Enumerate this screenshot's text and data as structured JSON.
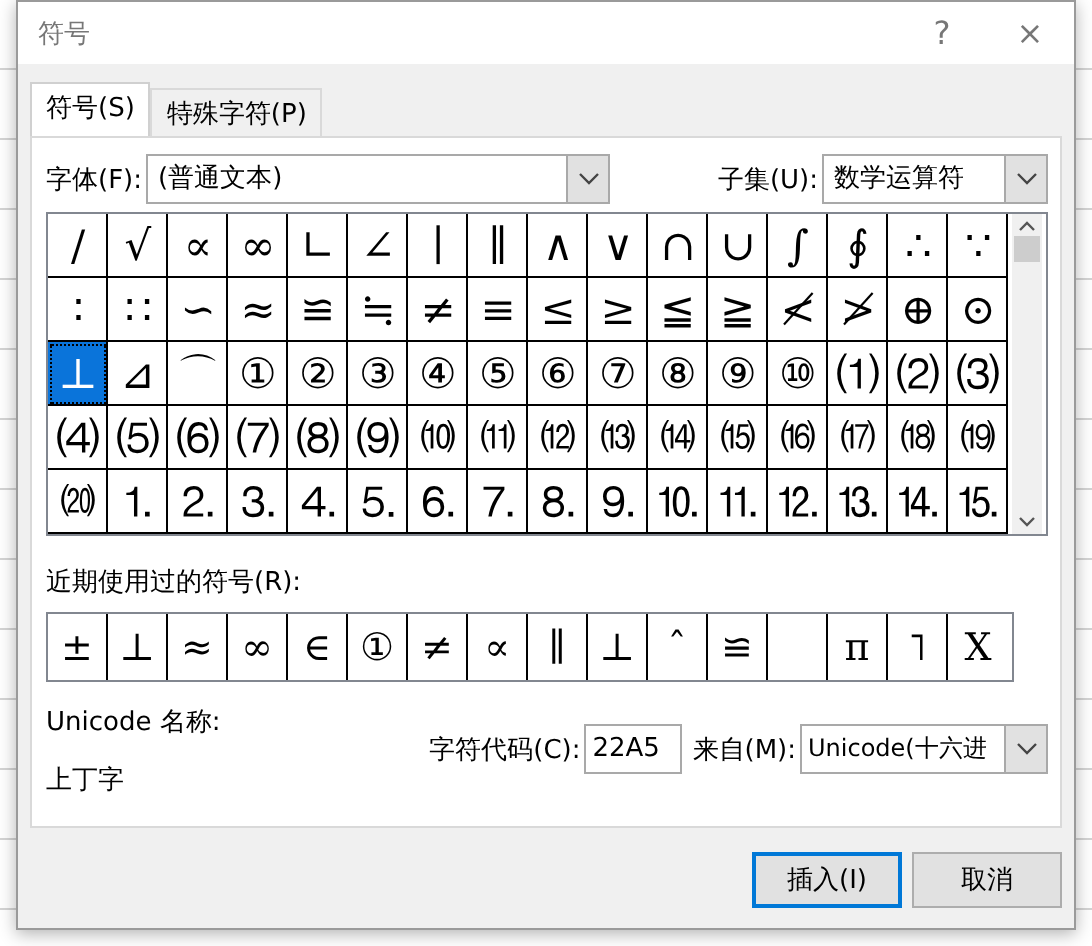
{
  "window": {
    "title": "符号",
    "help": "?",
    "close": "×"
  },
  "tabs": [
    {
      "label": "符号(S)",
      "selected": true
    },
    {
      "label": "特殊字符(P)",
      "selected": false
    }
  ],
  "font": {
    "label": "字体(F):",
    "value": "(普通文本)"
  },
  "subset": {
    "label": "子集(U):",
    "value": "数学运算符"
  },
  "symbols": [
    {
      "char": "/",
      "selected": false
    },
    {
      "char": "√",
      "selected": false
    },
    {
      "char": "∝",
      "selected": false
    },
    {
      "char": "∞",
      "selected": false
    },
    {
      "char": "∟",
      "selected": false
    },
    {
      "char": "∠",
      "selected": false
    },
    {
      "char": "∣",
      "selected": false
    },
    {
      "char": "∥",
      "selected": false
    },
    {
      "char": "∧",
      "selected": false
    },
    {
      "char": "∨",
      "selected": false
    },
    {
      "char": "∩",
      "selected": false
    },
    {
      "char": "∪",
      "selected": false
    },
    {
      "char": "∫",
      "selected": false
    },
    {
      "char": "∮",
      "selected": false
    },
    {
      "char": "∴",
      "selected": false
    },
    {
      "char": "∵",
      "selected": false
    },
    {
      "char": "∶",
      "selected": false
    },
    {
      "char": "∷",
      "selected": false
    },
    {
      "char": "∽",
      "selected": false
    },
    {
      "char": "≈",
      "selected": false
    },
    {
      "char": "≌",
      "selected": false
    },
    {
      "char": "≒",
      "selected": false
    },
    {
      "char": "≠",
      "selected": false
    },
    {
      "char": "≡",
      "selected": false
    },
    {
      "char": "≤",
      "selected": false
    },
    {
      "char": "≥",
      "selected": false
    },
    {
      "char": "≦",
      "selected": false
    },
    {
      "char": "≧",
      "selected": false
    },
    {
      "char": "≮",
      "selected": false
    },
    {
      "char": "≯",
      "selected": false
    },
    {
      "char": "⊕",
      "selected": false
    },
    {
      "char": "⊙",
      "selected": false
    },
    {
      "char": "⊥",
      "selected": true
    },
    {
      "char": "⊿",
      "selected": false
    },
    {
      "char": "⌒",
      "selected": false
    },
    {
      "char": "①",
      "selected": false
    },
    {
      "char": "②",
      "selected": false
    },
    {
      "char": "③",
      "selected": false
    },
    {
      "char": "④",
      "selected": false
    },
    {
      "char": "⑤",
      "selected": false
    },
    {
      "char": "⑥",
      "selected": false
    },
    {
      "char": "⑦",
      "selected": false
    },
    {
      "char": "⑧",
      "selected": false
    },
    {
      "char": "⑨",
      "selected": false
    },
    {
      "char": "⑩",
      "selected": false
    },
    {
      "char": "⑴",
      "selected": false
    },
    {
      "char": "⑵",
      "selected": false
    },
    {
      "char": "⑶",
      "selected": false
    },
    {
      "char": "⑷",
      "selected": false
    },
    {
      "char": "⑸",
      "selected": false
    },
    {
      "char": "⑹",
      "selected": false
    },
    {
      "char": "⑺",
      "selected": false
    },
    {
      "char": "⑻",
      "selected": false
    },
    {
      "char": "⑼",
      "selected": false
    },
    {
      "char": "⑽",
      "selected": false
    },
    {
      "char": "⑾",
      "selected": false
    },
    {
      "char": "⑿",
      "selected": false
    },
    {
      "char": "⒀",
      "selected": false
    },
    {
      "char": "⒁",
      "selected": false
    },
    {
      "char": "⒂",
      "selected": false
    },
    {
      "char": "⒃",
      "selected": false
    },
    {
      "char": "⒄",
      "selected": false
    },
    {
      "char": "⒅",
      "selected": false
    },
    {
      "char": "⒆",
      "selected": false
    },
    {
      "char": "⒇",
      "selected": false
    },
    {
      "char": "⒈",
      "selected": false
    },
    {
      "char": "⒉",
      "selected": false
    },
    {
      "char": "⒊",
      "selected": false
    },
    {
      "char": "⒋",
      "selected": false
    },
    {
      "char": "⒌",
      "selected": false
    },
    {
      "char": "⒍",
      "selected": false
    },
    {
      "char": "⒎",
      "selected": false
    },
    {
      "char": "⒏",
      "selected": false
    },
    {
      "char": "⒐",
      "selected": false
    },
    {
      "char": "⒑",
      "selected": false
    },
    {
      "char": "⒒",
      "selected": false
    },
    {
      "char": "⒓",
      "selected": false
    },
    {
      "char": "⒔",
      "selected": false
    },
    {
      "char": "⒕",
      "selected": false
    },
    {
      "char": "⒖",
      "selected": false
    }
  ],
  "recent": {
    "label": "近期使用过的符号(R):",
    "items": [
      {
        "kind": "symbol",
        "char": "±"
      },
      {
        "kind": "symbol",
        "char": "⊥"
      },
      {
        "kind": "symbol",
        "char": "≈"
      },
      {
        "kind": "symbol",
        "char": "∞"
      },
      {
        "kind": "symbol",
        "char": "∈"
      },
      {
        "kind": "symbol",
        "char": "①"
      },
      {
        "kind": "symbol",
        "char": "≠"
      },
      {
        "kind": "symbol",
        "char": "∝"
      },
      {
        "kind": "symbol",
        "char": "∥"
      },
      {
        "kind": "symbol",
        "char": "⊥"
      },
      {
        "kind": "symbol",
        "char": "ˆ"
      },
      {
        "kind": "symbol",
        "char": "≌"
      },
      {
        "kind": "blank"
      },
      {
        "kind": "symbol",
        "char": "π"
      },
      {
        "kind": "symbol",
        "char": "˥"
      },
      {
        "kind": "symbol",
        "char": "X"
      }
    ]
  },
  "unicode_name": {
    "label": "Unicode 名称:",
    "value": "上丁字"
  },
  "char_code": {
    "label": "字符代码(C):",
    "value": "22A5"
  },
  "from": {
    "label": "来自(M):",
    "value": "Unicode(十六进"
  },
  "buttons": [
    {
      "label": "插入(I)",
      "kind": "default"
    },
    {
      "label": "取消",
      "kind": "normal"
    }
  ]
}
